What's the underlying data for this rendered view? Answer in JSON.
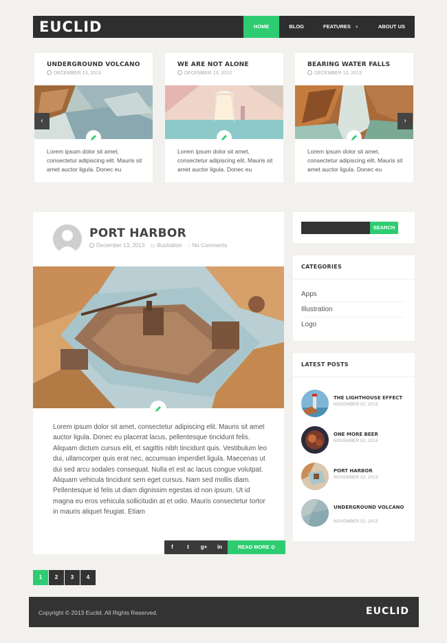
{
  "header": {
    "logo": "EUCLID",
    "nav": [
      "HOME",
      "BLOG",
      "FEATURES",
      "ABOUT US"
    ]
  },
  "slider": {
    "cards": [
      {
        "title": "UNDERGROUND VOLCANO",
        "date": "DECEMBER 13, 2013",
        "text": "Lorem ipsum dolor sit amet, consectetur adipiscing elit. Mauris sit amet auctor ligula. Donec eu"
      },
      {
        "title": "WE ARE NOT ALONE",
        "date": "DECEMBER 13, 2013",
        "text": "Lorem ipsum dolor sit amet, consectetur adipiscing elit. Mauris sit amet auctor ligula. Donec eu"
      },
      {
        "title": "BEARING WATER FALLS",
        "date": "DECEMBER 13, 2013",
        "text": "Lorem ipsum dolor sit amet, consectetur adipiscing elit. Mauris sit amet auctor ligula. Donec eu"
      }
    ],
    "prev_icon": "chevron-left-icon",
    "next_icon": "chevron-right-icon"
  },
  "post": {
    "title": "PORT HARBOR",
    "date": "December 13, 2013",
    "category": "Illustration",
    "comments": "No Comments",
    "body": "Lorem ipsum dolor sit amet, consectetur adipiscing elit. Mauris sit amet auctor ligula. Donec eu placerat lacus, pellentesque tincidunt felis. Aliquam dictum cursus elit, et sagittis nibh tincidunt quis. Vestibulum leo dui, ullamcorper quis erat nec, accumsan imperdiet ligula. Maecenas ut dui sed arcu sodales consequat. Nulla et est ac lacus congue volutpat. Aliquam vehicula tincidunt sem eget cursus. Nam sed mollis diam. Pellentesque id felis ut diam dignissim egestas id non ipsum. Ut id magna eu eros vehicula sollicitudin at et odio. Mauris consectetur tortor in mauris aliquet feugiat. Etiam",
    "share": [
      "f",
      "t",
      "g+",
      "in"
    ],
    "read_more": "READ MORE"
  },
  "sidebar": {
    "search_button": "SEARCH",
    "categories_title": "CATEGORIES",
    "categories": [
      "Apps",
      "Illustration",
      "Logo"
    ],
    "latest_title": "LATEST POSTS",
    "latest": [
      {
        "title": "THE LIGHTHOUSE EFFECT",
        "date": "NOVEMBER 02, 2013"
      },
      {
        "title": "ONE MORE BEER",
        "date": "NOVEMBER 02, 2013"
      },
      {
        "title": "PORT HARBOR",
        "date": "NOVEMBER 02, 2013"
      },
      {
        "title": "UNDERGROUND VOLCANO",
        "date": "NOVEMBER 02, 2013"
      }
    ]
  },
  "pagination": [
    "1",
    "2",
    "3",
    "4"
  ],
  "footer": {
    "copyright": "Copyright © 2013 Euclid. All Rights Reserved.",
    "logo": "EUCLID"
  },
  "colors": {
    "accent": "#2ecc71",
    "dark": "#2e2e2e",
    "background": "#f2f1ee"
  }
}
